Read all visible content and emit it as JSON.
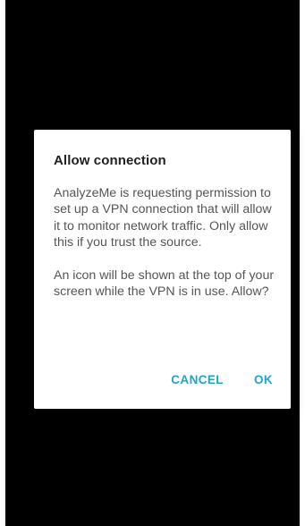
{
  "dialog": {
    "title": "Allow connection",
    "message_1": "AnalyzeMe is requesting permission to set up a VPN connection that will allow it to monitor network traffic. Only allow this if you trust the source.",
    "message_2": "An icon will be shown at the top of your screen while the VPN is in use. Allow?",
    "cancel_label": "CANCEL",
    "ok_label": "OK"
  },
  "colors": {
    "accent": "#1fa5c5",
    "backdrop": "#000000",
    "dialog_bg": "#ffffff"
  }
}
